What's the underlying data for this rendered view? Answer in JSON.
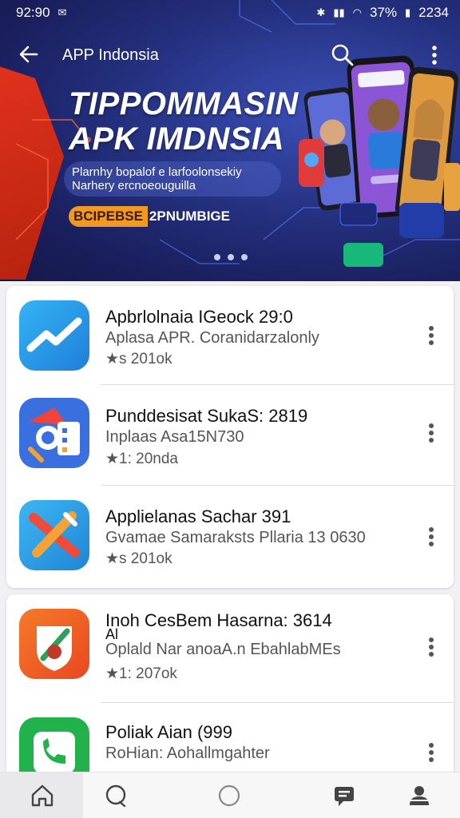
{
  "status_bar": {
    "time": "92:90",
    "battery_text": "37%",
    "clock_right": "2234"
  },
  "app_bar": {
    "title": "APP Indonsia"
  },
  "banner": {
    "headline_line1": "TIPPOMMASIN",
    "headline_line2": "APK IMDNSIA",
    "pill_line1": "Plarnhy bopalof e larfoolonsekiy",
    "pill_line2": "Narhery ercnoeouguilla",
    "promo_tag": "BCIPEBSE",
    "promo_rest": "2PNUMBIGE",
    "page_dots": 3
  },
  "apps": [
    {
      "name": "Apbrlolnaia IGeock 29:0",
      "sub": "Aplasa APR. Coranidarzalonly",
      "meta": "★s 201ok",
      "icon": "trend-icon",
      "color": "#2b9be8"
    },
    {
      "name": "Punddesisat SukaS: 2819",
      "sub": "Inplaas Asa15N730",
      "meta": "★1: 20nda",
      "icon": "tools-icon",
      "color": "#3a6fe0"
    },
    {
      "name": "Applielanas Sachar 391",
      "sub": "Gvamae Samaraksts Pllaria 13 0630",
      "meta": "★s 201ok",
      "icon": "pencil-icon",
      "color": "#2d9fe6"
    },
    {
      "name": "Inoh CesBem Hasarna: 3614",
      "name2": "Al",
      "sub": "Oplald Nar anoaA.n EbahlabMEs",
      "meta": "★1: 207ok",
      "icon": "shield-icon",
      "color": "#f05a24"
    },
    {
      "name": "Poliak Aian (999",
      "sub": "RoHian: Aohallmgahter",
      "meta": "",
      "icon": "phone-icon",
      "color": "#22b24c"
    }
  ],
  "bottom_nav": [
    "home",
    "chat",
    "circle",
    "message",
    "profile"
  ]
}
